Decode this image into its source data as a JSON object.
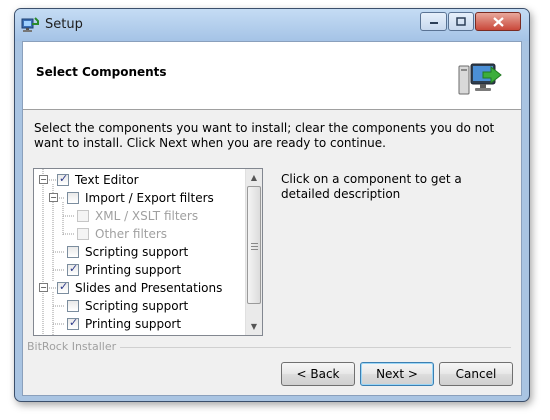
{
  "window": {
    "title": "Setup"
  },
  "header": {
    "title": "Select Components"
  },
  "instructions": "Select the components you want to install; clear the components you do not want to install. Click Next when you are ready to continue.",
  "tree": {
    "items": [
      {
        "label": "Text Editor",
        "checked": true,
        "enabled": true,
        "expanded": true
      },
      {
        "label": "Import / Export filters",
        "checked": false,
        "enabled": true,
        "expanded": true
      },
      {
        "label": "XML / XSLT filters",
        "checked": false,
        "enabled": false
      },
      {
        "label": "Other filters",
        "checked": false,
        "enabled": false
      },
      {
        "label": "Scripting support",
        "checked": false,
        "enabled": true
      },
      {
        "label": "Printing support",
        "checked": true,
        "enabled": true
      },
      {
        "label": "Slides and Presentations",
        "checked": true,
        "enabled": true,
        "expanded": true
      },
      {
        "label": "Scripting support",
        "checked": false,
        "enabled": true
      },
      {
        "label": "Printing support",
        "checked": true,
        "enabled": true
      }
    ]
  },
  "description": "Click on a component to get a detailed description",
  "footer": {
    "brand": "BitRock Installer",
    "back_label": "< Back",
    "next_label": "Next >",
    "cancel_label": "Cancel"
  },
  "colors": {
    "title_bar": "#a5c3e6",
    "close_button": "#c9483a",
    "dialog_background": "#f0f0f0",
    "default_button_border": "#3c7fb1"
  },
  "icons": {
    "app": "setup-app-icon",
    "header": "computer-install-icon"
  }
}
